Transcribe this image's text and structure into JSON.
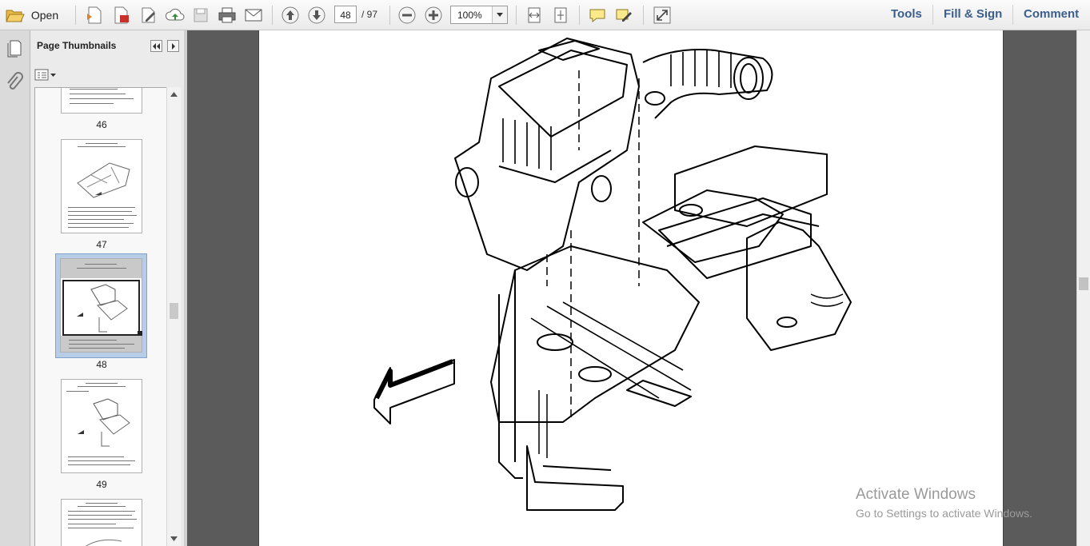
{
  "toolbar": {
    "open_label": "Open",
    "page_current": "48",
    "page_total": "/ 97",
    "zoom": "100%",
    "tools_label": "Tools",
    "fill_sign_label": "Fill & Sign",
    "comment_label": "Comment",
    "icons": [
      "open-folder-icon",
      "create-pdf-icon",
      "export-pdf-icon",
      "edit-icon",
      "upload-icon",
      "save-icon",
      "print-icon",
      "email-icon",
      "prev-page-icon",
      "next-page-icon",
      "zoom-out-icon",
      "zoom-in-icon",
      "fit-width-icon",
      "fit-page-icon",
      "comment-icon",
      "highlight-icon",
      "fullscreen-icon"
    ]
  },
  "panel": {
    "title": "Page Thumbnails",
    "thumbnails": [
      {
        "label": "46",
        "selected": false
      },
      {
        "label": "47",
        "selected": false
      },
      {
        "label": "48",
        "selected": true
      },
      {
        "label": "49",
        "selected": false
      },
      {
        "label": "",
        "selected": false
      }
    ]
  },
  "watermark": {
    "title": "Activate Windows",
    "subtitle": "Go to Settings to activate Windows."
  },
  "colors": {
    "toolbar_link": "#3b5e8c",
    "selection": "#b7cde6",
    "doc_background": "#5b5b5b"
  }
}
